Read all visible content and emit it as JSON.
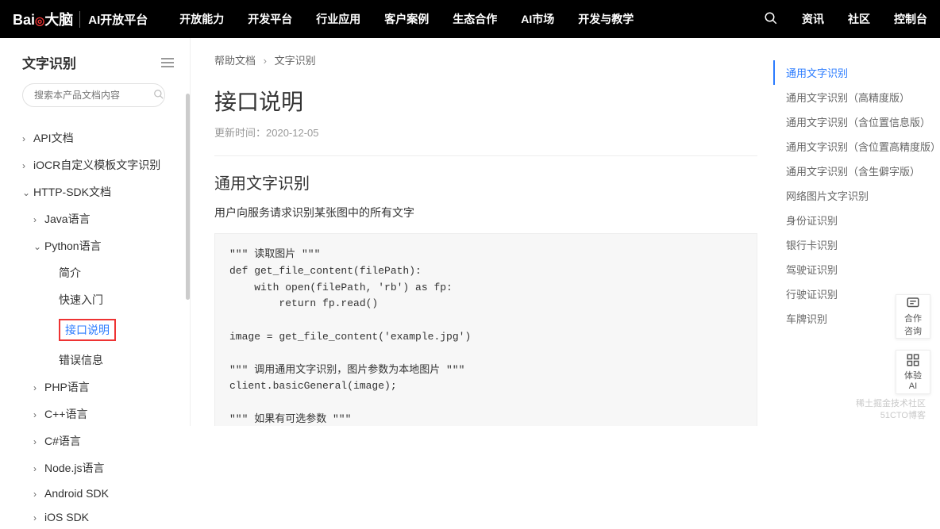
{
  "header": {
    "brand_logo": "Bai",
    "brand_logo_suffix": "大脑",
    "brand_sub": "AI开放平台",
    "nav": [
      "开放能力",
      "开发平台",
      "行业应用",
      "客户案例",
      "生态合作",
      "AI市场",
      "开发与教学"
    ],
    "right": [
      "资讯",
      "社区",
      "控制台"
    ]
  },
  "sidebar": {
    "title": "文字识别",
    "search_placeholder": "搜索本产品文档内容",
    "tree": [
      {
        "label": "API文档",
        "depth": 0,
        "chev": ">"
      },
      {
        "label": "iOCR自定义模板文字识别",
        "depth": 0,
        "chev": ">"
      },
      {
        "label": "HTTP-SDK文档",
        "depth": 0,
        "chev": "v"
      },
      {
        "label": "Java语言",
        "depth": 1,
        "chev": ">"
      },
      {
        "label": "Python语言",
        "depth": 1,
        "chev": "v"
      },
      {
        "label": "简介",
        "depth": 2,
        "chev": ""
      },
      {
        "label": "快速入门",
        "depth": 2,
        "chev": ""
      },
      {
        "label": "接口说明",
        "depth": 2,
        "chev": "",
        "active": true
      },
      {
        "label": "错误信息",
        "depth": 2,
        "chev": ""
      },
      {
        "label": "PHP语言",
        "depth": 1,
        "chev": ">"
      },
      {
        "label": "C++语言",
        "depth": 1,
        "chev": ">"
      },
      {
        "label": "C#语言",
        "depth": 1,
        "chev": ">"
      },
      {
        "label": "Node.js语言",
        "depth": 1,
        "chev": ">"
      },
      {
        "label": "Android SDK",
        "depth": 1,
        "chev": ">"
      },
      {
        "label": "iOS SDK",
        "depth": 1,
        "chev": ">"
      }
    ]
  },
  "breadcrumb": {
    "a": "帮助文档",
    "b": "文字识别"
  },
  "page": {
    "title": "接口说明",
    "updated_label": "更新时间：",
    "updated_value": "2020-12-05",
    "section_title": "通用文字识别",
    "section_desc": "用户向服务请求识别某张图中的所有文字",
    "code": "\"\"\" 读取图片 \"\"\"\ndef get_file_content(filePath):\n    with open(filePath, 'rb') as fp:\n        return fp.read()\n\nimage = get_file_content('example.jpg')\n\n\"\"\" 调用通用文字识别，图片参数为本地图片 \"\"\"\nclient.basicGeneral(image);\n\n\"\"\" 如果有可选参数 \"\"\"\noptions = {}\noptions[\"language_type\"] = \"CHN_ENG\"\noptions[\"detect_direction\"] = \"true\"\noptions[\"detect_language\"] = \"true\"\noptions[\"probability\"] = \"true\""
  },
  "rightnav": [
    {
      "label": "通用文字识别",
      "active": true
    },
    {
      "label": "通用文字识别（高精度版）"
    },
    {
      "label": "通用文字识别（含位置信息版）"
    },
    {
      "label": "通用文字识别（含位置高精度版）"
    },
    {
      "label": "通用文字识别（含生僻字版）"
    },
    {
      "label": "网络图片文字识别"
    },
    {
      "label": "身份证识别"
    },
    {
      "label": "银行卡识别"
    },
    {
      "label": "驾驶证识别"
    },
    {
      "label": "行驶证识别"
    },
    {
      "label": "车牌识别"
    }
  ],
  "float": {
    "a": "合作\n咨询",
    "b": "体验\nAI"
  },
  "watermark": {
    "a": "稀土掘金技术社区",
    "b": "51CTO博客"
  }
}
